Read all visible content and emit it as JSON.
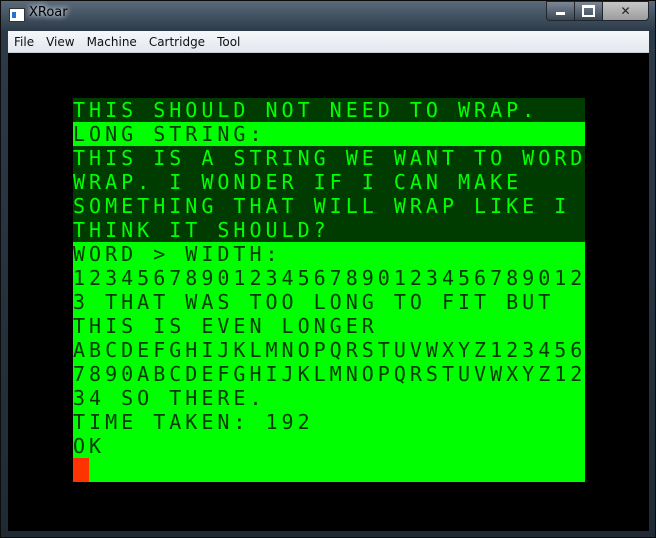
{
  "window": {
    "title": "XRoar",
    "controls": {
      "minimize": "",
      "maximize": "",
      "close": "✕"
    }
  },
  "menu": [
    "File",
    "View",
    "Machine",
    "Cartridge",
    "Tool"
  ],
  "screen": {
    "lines": [
      "THIS SHOULD NOT NEED TO WRAP.",
      "LONG STRING:",
      "THIS IS A STRING WE WANT TO WORD",
      "WRAP. I WONDER IF I CAN MAKE",
      "SOMETHING THAT WILL WRAP LIKE I",
      "THINK IT SHOULD?",
      "WORD > WIDTH:",
      "12345678901234567890123456789012",
      "3 THAT WAS TOO LONG TO FIT BUT",
      "THIS IS EVEN LONGER",
      "ABCDEFGHIJKLMNOPQRSTUVWXYZ123456",
      "7890ABCDEFGHIJKLMNOPQRSTUVWXYZ12",
      "34 SO THERE.",
      "TIME TAKEN: 192",
      "OK"
    ],
    "colors": {
      "background": "#00ff00",
      "text": "#003c00",
      "cursor": "#ff3300"
    }
  }
}
